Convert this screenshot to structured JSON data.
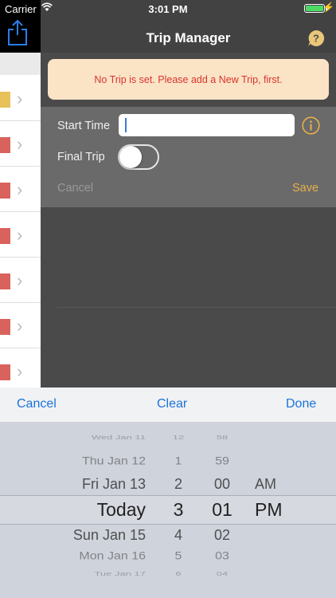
{
  "status_bar": {
    "carrier": "Carrier",
    "time": "3:01 PM"
  },
  "header": {
    "title": "Trip Manager"
  },
  "banner": {
    "message": "No Trip is set. Please add a New Trip, first."
  },
  "form": {
    "start_time_label": "Start Time",
    "start_time_value": "",
    "final_trip_label": "Final Trip",
    "final_trip_on": false,
    "cancel_label": "Cancel",
    "save_label": "Save"
  },
  "list_swatch_colors": [
    "#e7c25a",
    "#d9625c",
    "#d9625c",
    "#d9625c",
    "#d9625c",
    "#d9625c",
    "#d9625c"
  ],
  "picker_toolbar": {
    "cancel_label": "Cancel",
    "clear_label": "Clear",
    "done_label": "Done"
  },
  "picker": {
    "date_column": [
      "Wed Jan 11",
      "Thu Jan 12",
      "Fri Jan 13",
      "Today",
      "Sun Jan 15",
      "Mon Jan 16",
      "Tue Jan 17"
    ],
    "hour_column": [
      "12",
      "1",
      "2",
      "3",
      "4",
      "5",
      "6"
    ],
    "minute_column": [
      "58",
      "59",
      "00",
      "01",
      "02",
      "03",
      "04"
    ],
    "ampm_column": [
      "AM",
      "PM"
    ],
    "selected": {
      "date": "Today",
      "hour": "3",
      "minute": "01",
      "ampm": "PM"
    }
  },
  "colors": {
    "accent_blue": "#1a73d9",
    "save_orange": "#e8b04a",
    "banner_text_red": "#d8352c",
    "banner_bg": "#fbe3c6",
    "toggle_off_bg": "#6a6a6a"
  },
  "icons": {
    "share": "share-icon",
    "help": "help-bubble-icon",
    "info": "info-icon",
    "chevron": "chevron-right-icon"
  }
}
